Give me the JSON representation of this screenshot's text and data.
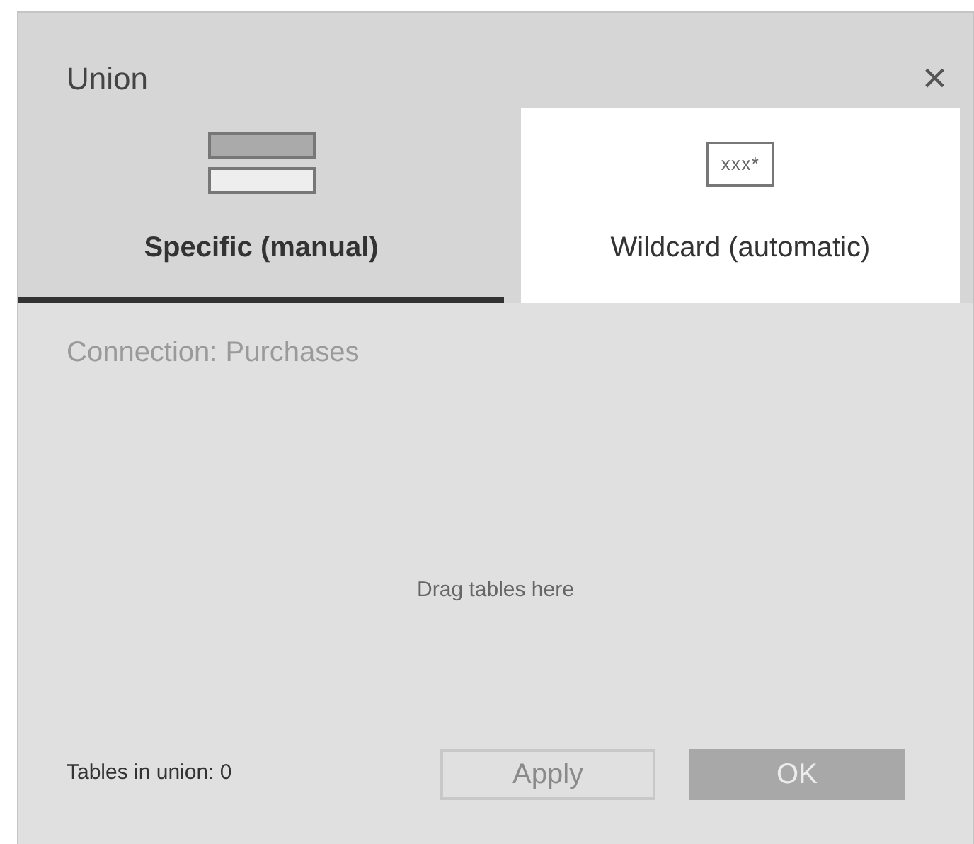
{
  "dialog": {
    "title": "Union",
    "close": "×"
  },
  "tabs": [
    {
      "label": "Specific (manual)",
      "kind": "stack",
      "selected": true,
      "hovered": false
    },
    {
      "label": "Wildcard (automatic)",
      "kind": "pattern",
      "selected": false,
      "hovered": true,
      "icon_text": "xxx*"
    }
  ],
  "connection": "Connection: Purchases",
  "drop_hint": "Drag tables here",
  "footer": {
    "count": "Tables in union: 0",
    "buttons": [
      {
        "label": "Apply",
        "kind": "outline",
        "disabled": true
      },
      {
        "label": "OK",
        "kind": "primary",
        "disabled": true
      }
    ]
  }
}
